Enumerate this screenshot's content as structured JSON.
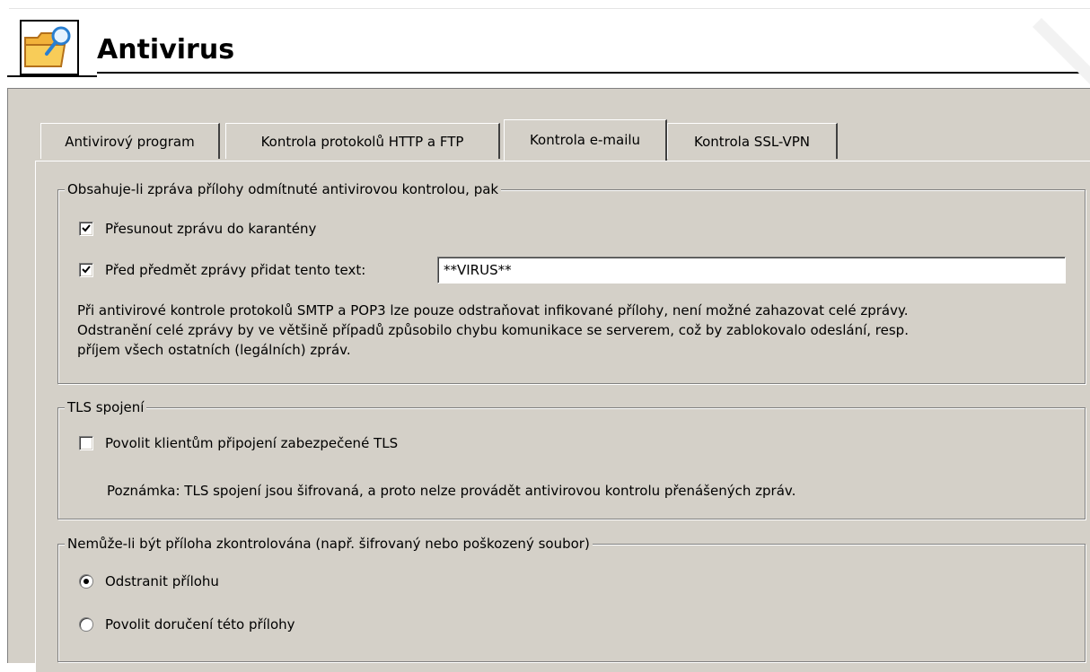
{
  "header": {
    "title": "Antivirus",
    "icon": "folder-search-icon"
  },
  "tabs": [
    {
      "label": "Antivirový program",
      "active": false
    },
    {
      "label": "Kontrola protokolů HTTP a FTP",
      "active": false
    },
    {
      "label": "Kontrola e-mailu",
      "active": true
    },
    {
      "label": "Kontrola SSL-VPN",
      "active": false
    }
  ],
  "infected_group": {
    "legend": "Obsahuje-li zpráva přílohy odmítnuté antivirovou kontrolou, pak",
    "quarantine": {
      "label": "Přesunout zprávu do karantény",
      "checked": true
    },
    "prefix": {
      "label": "Před předmět zprávy přidat tento text:",
      "checked": true,
      "value": "**VIRUS**"
    },
    "note_lines": [
      "Při antivirové kontrole protokolů SMTP a POP3 lze pouze odstraňovat infikované přílohy, není možné zahazovat celé zprávy.",
      "Odstranění celé zprávy by ve většině případů způsobilo chybu komunikace se serverem, což by zablokovalo odeslání, resp.",
      "příjem všech ostatních (legálních) zpráv."
    ]
  },
  "tls_group": {
    "legend": "TLS spojení",
    "allow": {
      "label": "Povolit klientům připojení zabezpečené TLS",
      "checked": false
    },
    "note": "Poznámka: TLS spojení jsou šifrovaná, a proto nelze provádět antivirovou kontrolu přenášených zpráv."
  },
  "unscannable_group": {
    "legend": "Nemůže-li být příloha zkontrolována (např. šifrovaný nebo poškozený soubor)",
    "options": [
      {
        "label": "Odstranit přílohu",
        "selected": true
      },
      {
        "label": "Povolit doručení této přílohy",
        "selected": false
      }
    ]
  },
  "colors": {
    "dialog_bg": "#d4d0c8",
    "shadow": "#808080",
    "highlight": "#ffffff"
  }
}
